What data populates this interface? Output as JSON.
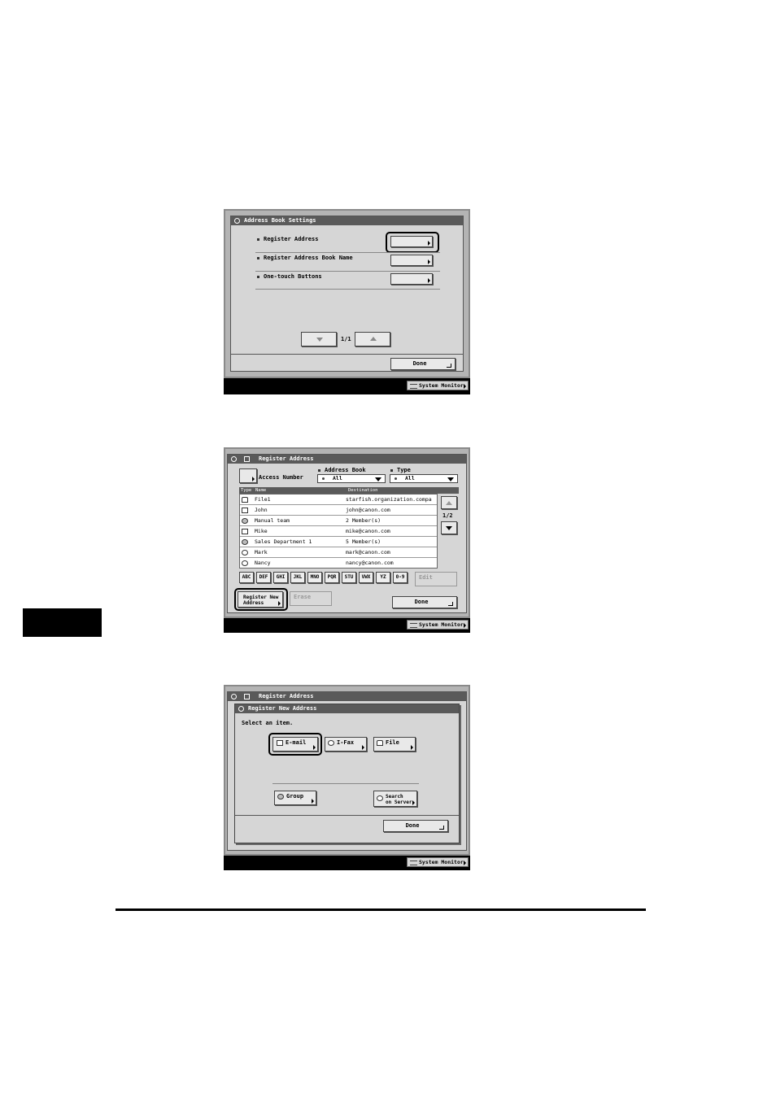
{
  "screen1": {
    "title": "Address Book Settings",
    "items": [
      {
        "label": "Register Address"
      },
      {
        "label": "Register Address Book Name"
      },
      {
        "label": "One-touch Buttons"
      }
    ],
    "page": "1/1",
    "done": "Done",
    "system_monitor": "System Monitor"
  },
  "screen2": {
    "title": "Register Address",
    "access_number": "Access Number",
    "address_book_label": "Address Book",
    "address_book_value": "All",
    "type_label": "Type",
    "type_value": "All",
    "columns": [
      "Type",
      "Name",
      "Destination"
    ],
    "rows": [
      {
        "icon": "file-icon",
        "name": "File1",
        "dest": "starfish.organization.compa"
      },
      {
        "icon": "email-icon",
        "name": "John",
        "dest": "john@canon.com"
      },
      {
        "icon": "group-icon",
        "name": "Manual team",
        "dest": "2 Member(s)"
      },
      {
        "icon": "email-icon",
        "name": "Mike",
        "dest": "mike@canon.com"
      },
      {
        "icon": "group-icon",
        "name": "Sales Department 1",
        "dest": "5 Member(s)"
      },
      {
        "icon": "ifax-icon",
        "name": "Mark",
        "dest": "mark@canon.com"
      },
      {
        "icon": "ifax-icon",
        "name": "Nancy",
        "dest": "nancy@canon.com"
      }
    ],
    "page": "1/2",
    "keys": [
      "ABC",
      "DEF",
      "GHI",
      "JKL",
      "MNO",
      "PQR",
      "STU",
      "VWX",
      "YZ",
      "0-9"
    ],
    "edit": "Edit",
    "register_new_line1": "Register New",
    "register_new_line2": "Address",
    "erase": "Erase",
    "done": "Done",
    "system_monitor": "System Monitor"
  },
  "screen3": {
    "title": "Register Address",
    "dialog_title": "Register New Address",
    "prompt": "Select an item.",
    "email": "E-mail",
    "ifax": "I-Fax",
    "file": "File",
    "group": "Group",
    "search_line1": "Search",
    "search_line2": "on Server",
    "done": "Done",
    "system_monitor": "System Monitor"
  }
}
